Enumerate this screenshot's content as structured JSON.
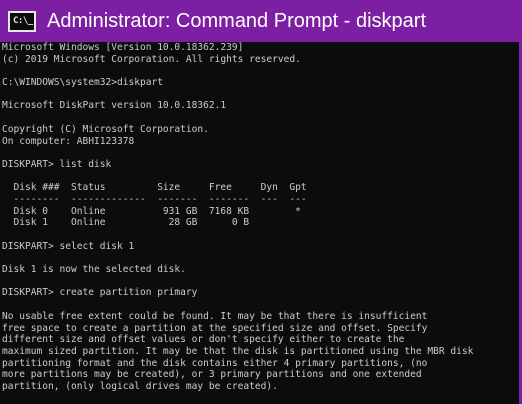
{
  "window": {
    "icon_text": "C:\\_",
    "title": "Administrator: Command Prompt - diskpart",
    "accent_color": "#7c1fa2"
  },
  "console": {
    "lines": [
      "Microsoft Windows [Version 10.0.18362.239]",
      "(c) 2019 Microsoft Corporation. All rights reserved.",
      "",
      "C:\\WINDOWS\\system32>diskpart",
      "",
      "Microsoft DiskPart version 10.0.18362.1",
      "",
      "Copyright (C) Microsoft Corporation.",
      "On computer: ABHI123378",
      "",
      "DISKPART> list disk",
      "",
      "  Disk ###  Status         Size     Free     Dyn  Gpt",
      "  --------  -------------  -------  -------  ---  ---",
      "  Disk 0    Online          931 GB  7168 KB        *",
      "  Disk 1    Online           28 GB      0 B",
      "",
      "DISKPART> select disk 1",
      "",
      "Disk 1 is now the selected disk.",
      "",
      "DISKPART> create partition primary",
      "",
      "No usable free extent could be found. It may be that there is insufficient",
      "free space to create a partition at the specified size and offset. Specify",
      "different size and offset values or don't specify either to create the",
      "maximum sized partition. It may be that the disk is partitioned using the MBR disk",
      "partitioning format and the disk contains either 4 primary partitions, (no",
      "more partitions may be created), or 3 primary partitions and one extended",
      "partition, (only logical drives may be created)."
    ]
  }
}
